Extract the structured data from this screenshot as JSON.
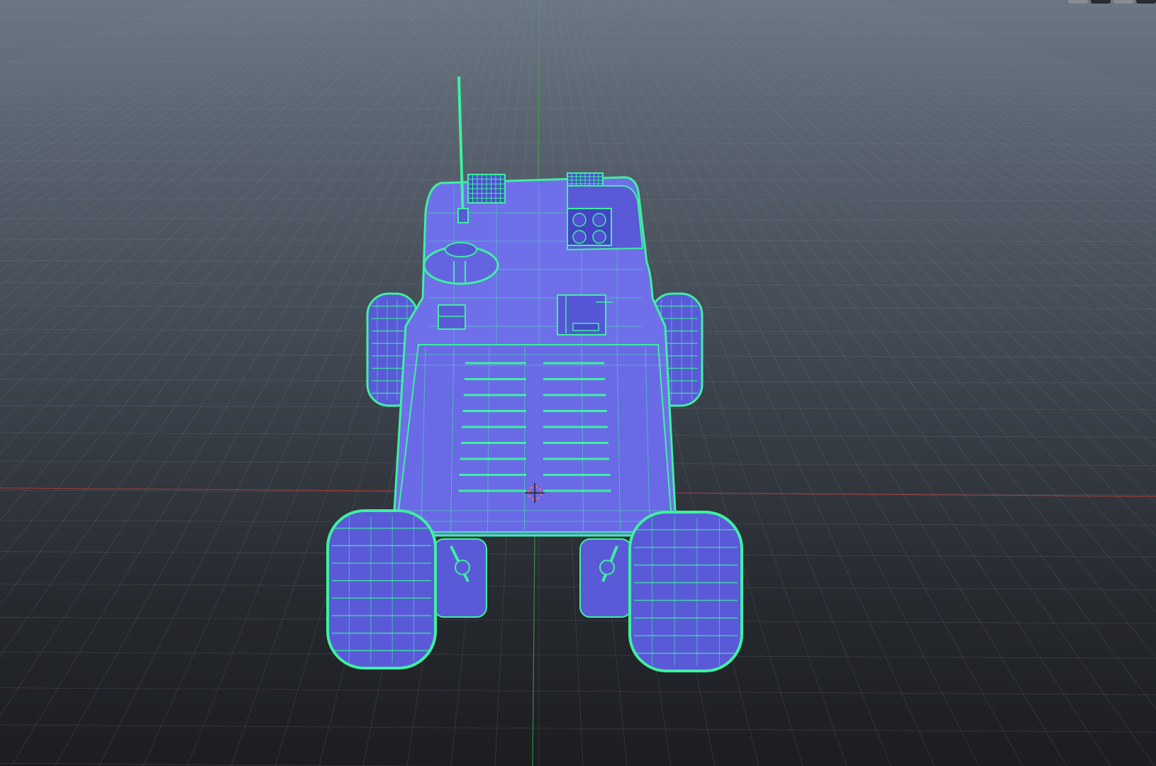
{
  "viewport": {
    "mode": "perspective",
    "shading": "wireframe-on-shaded",
    "grid": true,
    "axes": {
      "x_axis_color": "#b23a3a",
      "y_axis_color": "#3aa83a"
    }
  },
  "colors": {
    "background_top": "#6b7684",
    "background_bottom": "#1b1d21",
    "grid_line": "#8a95a3",
    "mesh_fill": "#6f6fea",
    "mesh_fill_dark": "#5050d0",
    "wireframe": "#3ef0a0",
    "cursor": "#ff6a6a"
  },
  "model": {
    "type": "rover",
    "parts": [
      "chassis",
      "front-hood",
      "antenna",
      "dome-sensor",
      "launcher-box",
      "vent-slats",
      "front-left-wheel",
      "front-right-wheel",
      "rear-left-wheel",
      "rear-right-wheel"
    ]
  },
  "widgets": {
    "items": [
      "view-toggle",
      "shading-toggle",
      "overlay-toggle",
      "layout-toggle"
    ]
  }
}
